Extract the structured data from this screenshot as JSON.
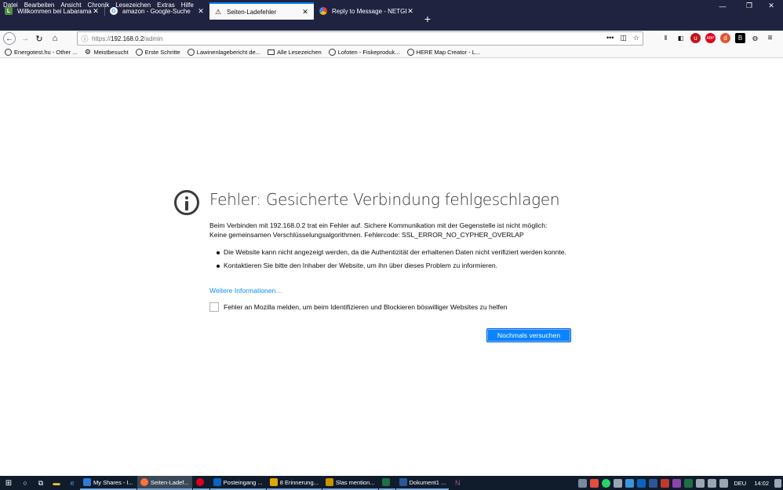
{
  "menu": [
    "Datei",
    "Bearbeiten",
    "Ansicht",
    "Chronik",
    "Lesezeichen",
    "Extras",
    "Hilfe"
  ],
  "window_controls": {
    "minimize": "—",
    "restore": "❐",
    "close": "✕"
  },
  "tabs": [
    {
      "title": "Willkommen bei Labarama!",
      "close": "✕",
      "icon": "labarama-icon"
    },
    {
      "title": "amazon - Google-Suche",
      "close": "✕",
      "icon": "google-icon"
    },
    {
      "title": "Seiten-Ladefehler",
      "close": "✕",
      "icon": "warning-icon"
    },
    {
      "title": "Reply to Message - NETGEAR C",
      "close": "✕",
      "icon": "netgear-icon"
    }
  ],
  "new_tab": "+",
  "url": {
    "scheme": "https://",
    "host": "192.168.0.2",
    "path": "/admin"
  },
  "url_actions": [
    "•••",
    "◫",
    "☆"
  ],
  "bookmarks": [
    {
      "label": "Energotest.hu - Other ...",
      "icon": "globe-icon"
    },
    {
      "label": "Meistbesucht",
      "icon": "gear-icon"
    },
    {
      "label": "Erste Schritte",
      "icon": "globe-icon"
    },
    {
      "label": "Lawinenlagebericht de...",
      "icon": "globe-icon"
    },
    {
      "label": "Alle Lesezeichen",
      "icon": "folder-icon"
    },
    {
      "label": "Lofoten - Fiskeproduk...",
      "icon": "globe-icon"
    },
    {
      "label": "HERE Map Creator - L...",
      "icon": "globe-icon"
    }
  ],
  "error": {
    "title": "Fehler: Gesicherte Verbindung fehlgeschlagen",
    "desc_line1": "Beim Verbinden mit 192.168.0.2 trat ein Fehler auf. Sichere Kommunikation mit der Gegenstelle ist nicht möglich:",
    "desc_line2": "Keine gemeinsamen Verschlüsselungsalgorithmen. Fehlercode: SSL_ERROR_NO_CYPHER_OVERLAP",
    "bullets": [
      "Die Website kann nicht angezeigt werden, da die Authentizität der erhaltenen Daten nicht verifiziert werden konnte.",
      "Kontaktieren Sie bitte den Inhaber der Website, um ihn über dieses Problem zu informieren."
    ],
    "more_info": "Weitere Informationen…",
    "report_label": "Fehler an Mozilla melden, um beim Identifizieren und Blockieren böswilliger Websites zu helfen",
    "retry_button": "Nochmals versuchen"
  },
  "taskbar": {
    "apps": [
      {
        "label": "My Shares - I...",
        "color": "#2f7bd6"
      },
      {
        "label": "Seiten-Ladef...",
        "color": "#ff7139",
        "active": true
      },
      {
        "label": "",
        "color": "#e2001a"
      },
      {
        "label": "Posteingang ...",
        "color": "#0a64c2"
      },
      {
        "label": "8 Erinnerung...",
        "color": "#e0a800"
      },
      {
        "label": "Slas mention...",
        "color": "#c99400"
      },
      {
        "label": "",
        "color": "#1d7044"
      },
      {
        "label": "Dokument1 ...",
        "color": "#2b5797"
      }
    ],
    "lang": "DEU",
    "time": "14:02"
  }
}
